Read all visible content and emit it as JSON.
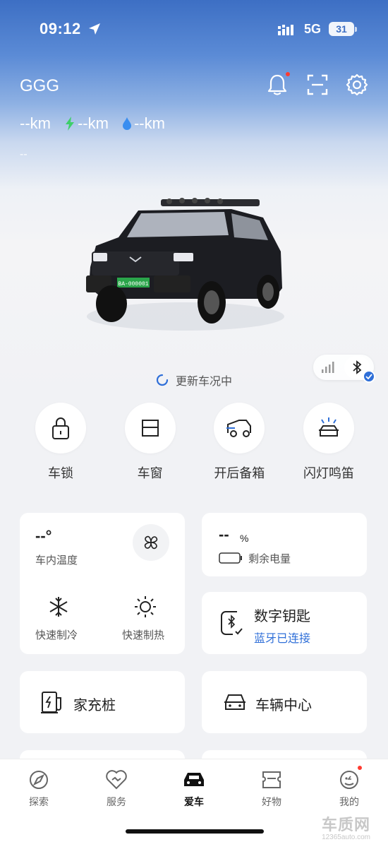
{
  "status_bar": {
    "time": "09:12",
    "network": "5G",
    "battery": "31"
  },
  "header": {
    "car_name": "GGG"
  },
  "range": {
    "total": "--km",
    "electric": "--km",
    "fuel": "--km",
    "sub_info": "--"
  },
  "car_image": {
    "plate": "BA-000001"
  },
  "connection": {
    "update_text": "更新车况中"
  },
  "controls": [
    {
      "label": "车锁",
      "icon": "lock-icon"
    },
    {
      "label": "车窗",
      "icon": "window-icon"
    },
    {
      "label": "开后备箱",
      "icon": "trunk-icon"
    },
    {
      "label": "闪灯鸣笛",
      "icon": "flash-horn-icon"
    }
  ],
  "climate": {
    "temp_value": "--°",
    "temp_label": "车内温度",
    "cool_label": "快速制冷",
    "heat_label": "快速制热"
  },
  "battery_card": {
    "value": "--",
    "unit": "%",
    "label": "剩余电量"
  },
  "digital_key": {
    "title": "数字钥匙",
    "status": "蓝牙已连接"
  },
  "charger": {
    "label": "家充桩"
  },
  "vehicle_center": {
    "label": "车辆中心"
  },
  "tabs": [
    {
      "label": "探索",
      "icon": "explore-icon"
    },
    {
      "label": "服务",
      "icon": "service-icon"
    },
    {
      "label": "爱车",
      "icon": "car-icon",
      "active": true
    },
    {
      "label": "好物",
      "icon": "shop-icon"
    },
    {
      "label": "我的",
      "icon": "profile-icon"
    }
  ],
  "watermark": {
    "big": "车质网",
    "small": "12365auto.com"
  },
  "colors": {
    "accent": "#2f6fd8",
    "hero_top": "#3d6fc4",
    "electric": "#3ecf6a",
    "fuel": "#3a8ef0",
    "alert": "#ff3b30"
  }
}
